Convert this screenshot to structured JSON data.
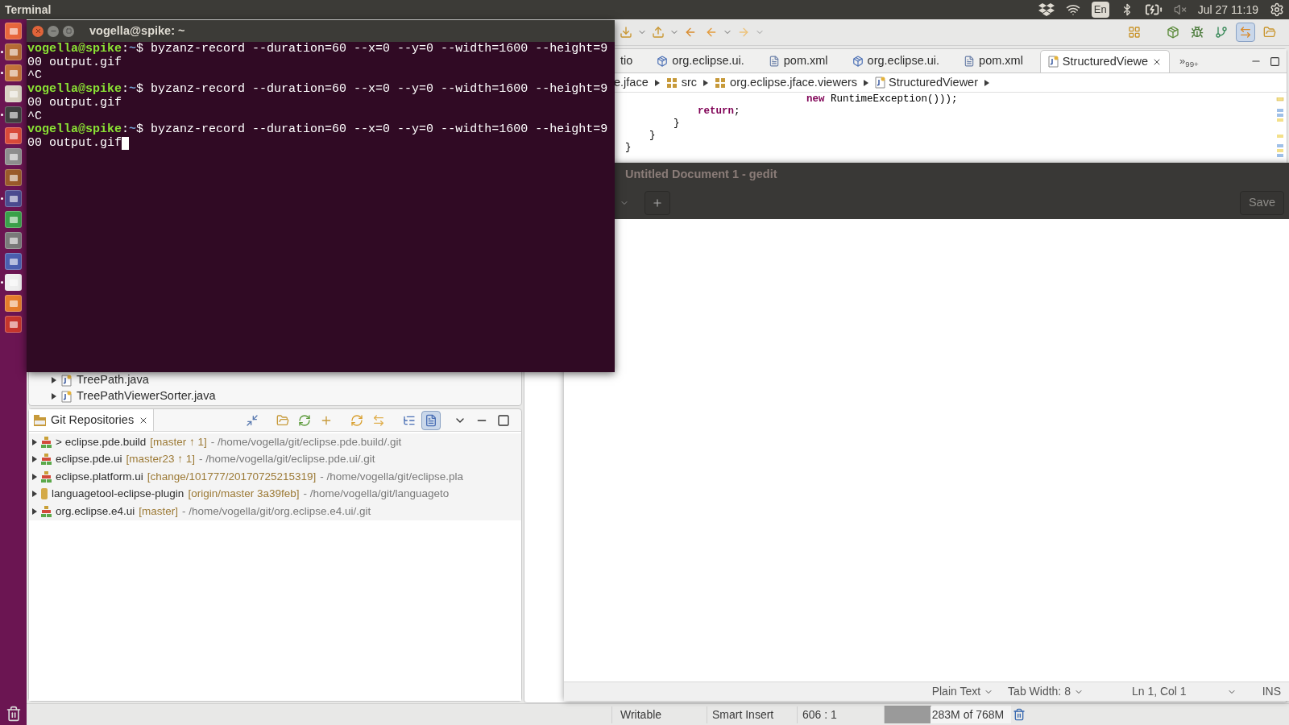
{
  "top_bar": {
    "app_title": "Terminal",
    "keyboard": "En",
    "clock": "Jul 27 11:19"
  },
  "launcher": {
    "items": [
      {
        "running": false
      },
      {
        "running": true
      },
      {
        "running": true
      },
      {
        "running": false
      },
      {
        "running": true
      },
      {
        "running": false
      },
      {
        "running": false
      },
      {
        "running": false
      },
      {
        "running": true
      },
      {
        "running": false
      },
      {
        "running": false
      },
      {
        "running": false
      },
      {
        "running": true
      },
      {
        "running": false
      },
      {
        "running": false
      }
    ]
  },
  "terminal": {
    "title": "vogella@spike: ~",
    "lines": [
      {
        "kind": "prompt",
        "user": "vogella@spike",
        "sep": ":",
        "cwd": "~",
        "end": "$",
        "command": "byzanz-record --duration=60 --x=0 --y=0 --width=1600 --height=9"
      },
      {
        "kind": "output",
        "text": "00 output.gif",
        "cursor": false
      },
      {
        "kind": "output",
        "text": "^C",
        "cursor": false
      },
      {
        "kind": "prompt",
        "user": "vogella@spike",
        "sep": ":",
        "cwd": "~",
        "end": "$",
        "command": "byzanz-record --duration=60 --x=0 --y=0 --width=1600 --height=9"
      },
      {
        "kind": "output",
        "text": "00 output.gif",
        "cursor": false
      },
      {
        "kind": "output",
        "text": "^C",
        "cursor": false
      },
      {
        "kind": "prompt",
        "user": "vogella@spike",
        "sep": ":",
        "cwd": "~",
        "end": "$",
        "command": "byzanz-record --duration=60 --x=0 --y=0 --width=1600 --height=9"
      },
      {
        "kind": "output",
        "text": "00 output.gif",
        "cursor": true
      }
    ]
  },
  "eclipse": {
    "editor_tabs": [
      {
        "label": "tio",
        "selected": false
      },
      {
        "label": "org.eclipse.ui.",
        "kind": "plugin",
        "selected": false
      },
      {
        "label": "pom.xml",
        "kind": "file",
        "selected": false
      },
      {
        "label": "org.eclipse.ui.",
        "kind": "plugin",
        "selected": false
      },
      {
        "label": "pom.xml",
        "kind": "file",
        "selected": false
      },
      {
        "label": "StructuredViewe",
        "kind": "class",
        "selected": true
      }
    ],
    "tab_overflow": {
      "marker": "»",
      "count": "99+"
    },
    "breadcrumb": [
      {
        "label": "e.jface"
      },
      {
        "label": "src",
        "kind": "package"
      },
      {
        "label": "org.eclipse.jface.viewers",
        "kind": "package"
      },
      {
        "label": "StructuredViewer",
        "kind": "class"
      }
    ],
    "code_lines": [
      "                                      **new** RuntimeException()));",
      "                    **return**;",
      "                }",
      "            }",
      "        }"
    ],
    "package_explorer": {
      "items": [
        {
          "name": "TreePath.java"
        },
        {
          "name": "TreePathViewerSorter.java"
        }
      ]
    },
    "git_repositories": {
      "title": "Git Repositories",
      "repos": [
        {
          "kind": "repo",
          "name": "> eclipse.pde.build",
          "branch": "[master ↑ 1]",
          "path": "- /home/vogella/git/eclipse.pde.build/.git"
        },
        {
          "kind": "repo",
          "name": "eclipse.pde.ui",
          "branch": "[master23 ↑ 1]",
          "path": "- /home/vogella/git/eclipse.pde.ui/.git"
        },
        {
          "kind": "repo",
          "name": "eclipse.platform.ui",
          "branch": "[change/101777/20170725215319]",
          "path": "- /home/vogella/git/eclipse.pla"
        },
        {
          "kind": "plain",
          "name": "languagetool-eclipse-plugin",
          "branch": "[origin/master 3a39feb]",
          "path": "- /home/vogella/git/languageto"
        },
        {
          "kind": "repo",
          "name": "org.eclipse.e4.ui",
          "branch": "[master]",
          "path": "- /home/vogella/git/org.eclipse.e4.ui/.git"
        }
      ]
    },
    "status_bar": {
      "mode": "Writable",
      "insert": "Smart Insert",
      "position": "606 : 1",
      "heap": {
        "label": "283M of 768M",
        "level": 0.37
      }
    }
  },
  "gedit": {
    "title": "Untitled Document 1 - gedit",
    "save": "Save",
    "status_bar": {
      "language": "Plain Text",
      "tab_width": "Tab Width: 8",
      "position": "Ln 1, Col 1",
      "mode": "INS"
    }
  }
}
